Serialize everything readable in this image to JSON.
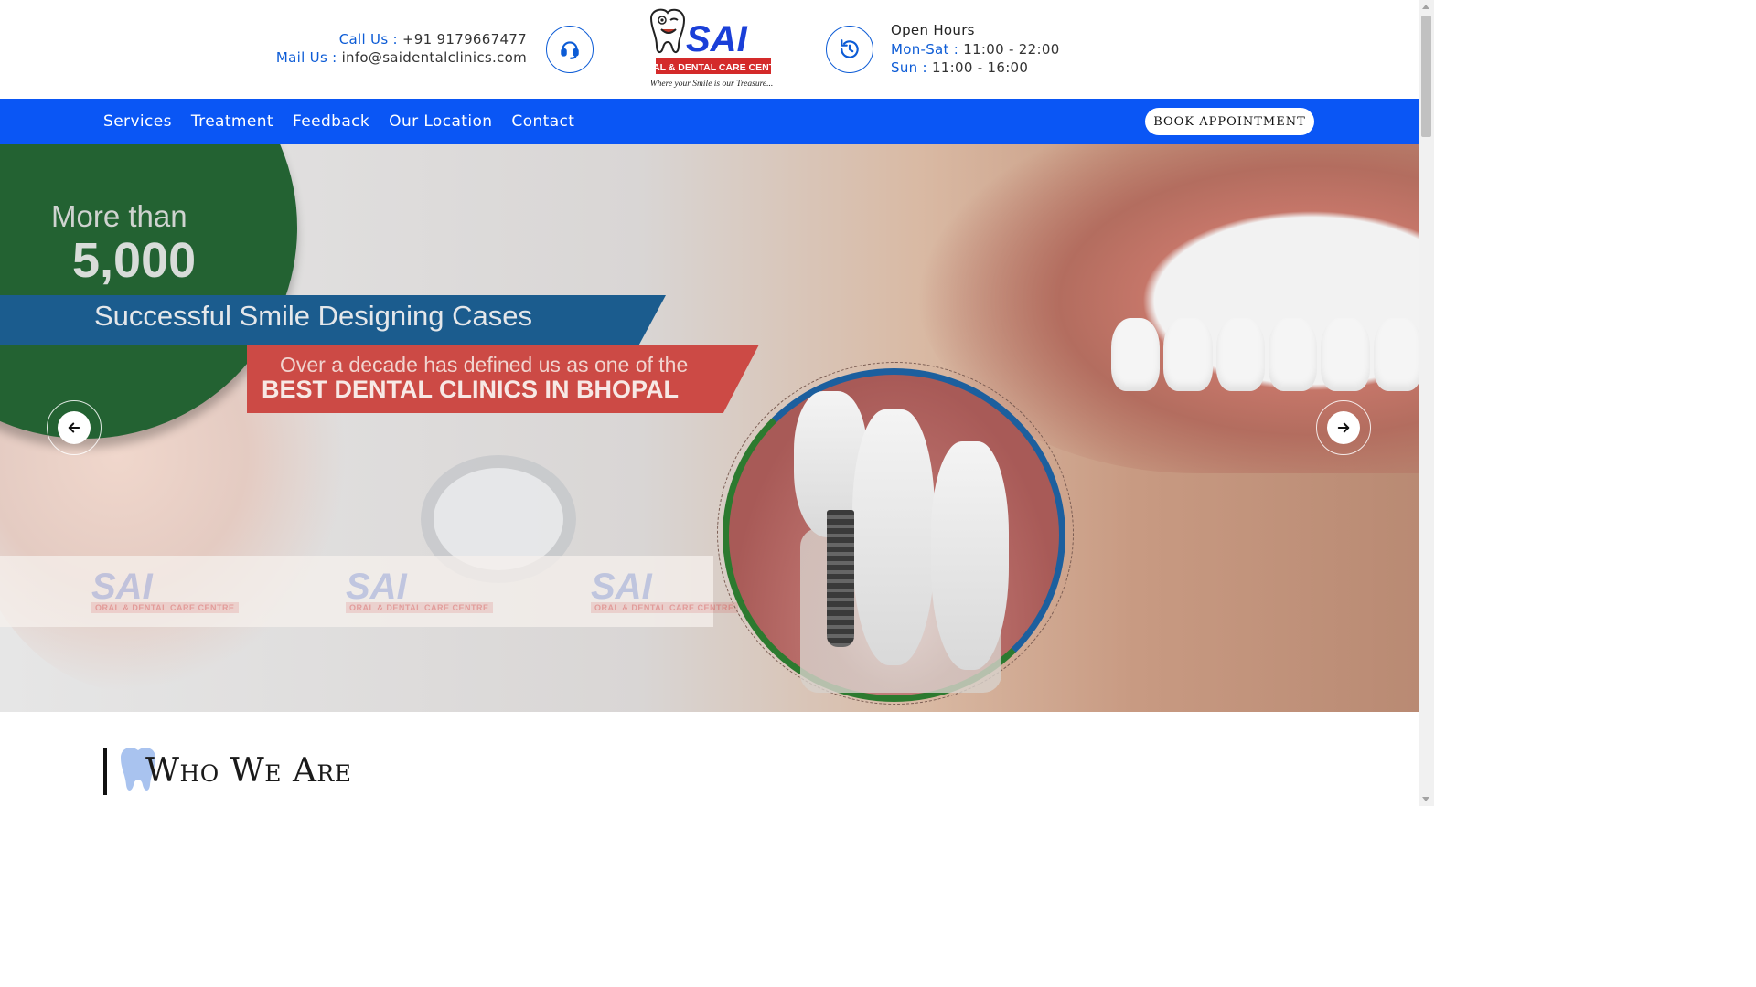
{
  "header": {
    "call_label": "Call Us :",
    "call_value": "+91 9179667477",
    "mail_label": "Mail Us :",
    "mail_value": "info@saidentalclinics.com",
    "phone_icon": "headset-icon",
    "hours_icon": "history-clock-icon",
    "hours_title": "Open Hours",
    "weekday_label": "Mon-Sat :",
    "weekday_hours": "11:00 - 22:00",
    "sunday_label": "Sun :",
    "sunday_hours": "11:00 - 16:00"
  },
  "logo": {
    "name": "SAI",
    "subtitle": "ORAL & DENTAL CARE CENTRE",
    "tagline": "Where your Smile is our Treasure...",
    "brand_blue": "#1a3fd8",
    "brand_red": "#d42a2a"
  },
  "nav": {
    "items": [
      "Services",
      "Treatment",
      "Feedback",
      "Our Location",
      "Contact"
    ],
    "book_label": "Book Appointment",
    "bg_color": "#0a56f5"
  },
  "hero": {
    "stat_prefix": "More than",
    "stat_number": "5,000",
    "banner_blue_text": "Successful Smile Designing Cases",
    "banner_red_line1": "Over a decade has defined us as one of the",
    "banner_red_line2": "BEST DENTAL CLINICS IN BHOPAL",
    "watermark_text": "SAI",
    "watermark_sub": "ORAL & DENTAL CARE CENTRE",
    "prev_icon": "arrow-left-icon",
    "next_icon": "arrow-right-icon"
  },
  "about": {
    "title": "Who We Are",
    "icon": "tooth-icon"
  }
}
